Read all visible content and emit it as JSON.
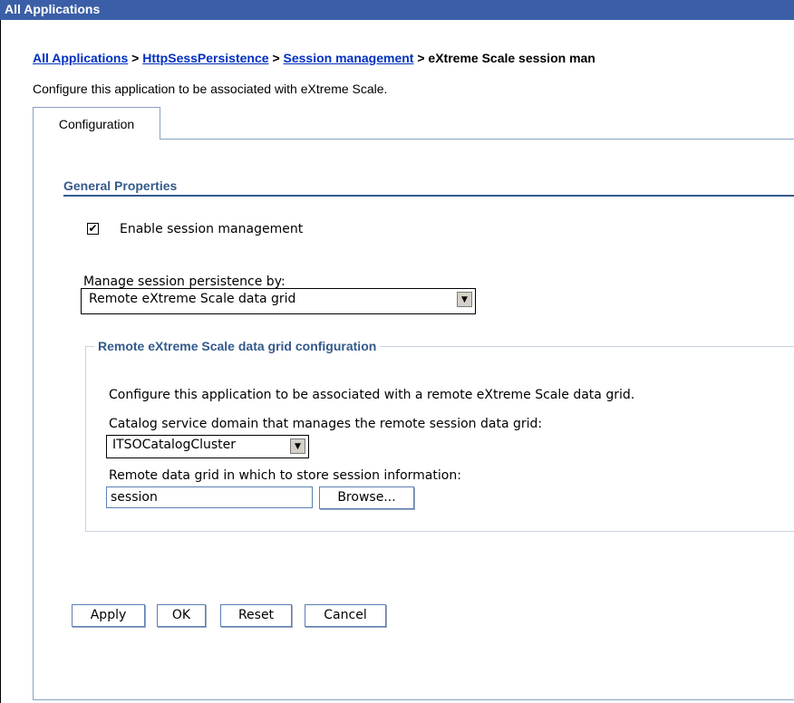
{
  "window": {
    "title": "All Applications"
  },
  "breadcrumb": {
    "links": [
      "All Applications",
      "HttpSessPersistence",
      "Session management"
    ],
    "separator": ">",
    "current": "eXtreme Scale session man"
  },
  "page": {
    "description": "Configure this application to be associated with eXtreme Scale."
  },
  "tabs": [
    {
      "label": "Configuration"
    }
  ],
  "general_properties": {
    "title": "General Properties",
    "enable_session_management": {
      "label": "Enable session management",
      "checked": true,
      "check_glyph": "✔"
    },
    "manage_by": {
      "label": "Manage session persistence by:",
      "selected": "Remote eXtreme Scale data grid"
    }
  },
  "remote_config": {
    "legend": "Remote eXtreme Scale data grid configuration",
    "description": "Configure this application to be associated with a remote eXtreme Scale data grid.",
    "catalog_label": "Catalog service domain that manages the remote session data grid:",
    "catalog_selected": "ITSOCatalogCluster",
    "grid_label": "Remote data grid in which to store session information:",
    "grid_value": "session",
    "browse_label": "Browse..."
  },
  "buttons": {
    "apply": "Apply",
    "ok": "OK",
    "reset": "Reset",
    "cancel": "Cancel"
  },
  "icons": {
    "dropdown": "▼"
  },
  "colors": {
    "title_bar": "#3b5fa6",
    "link": "#0030c0",
    "section_heading": "#345a8c"
  }
}
